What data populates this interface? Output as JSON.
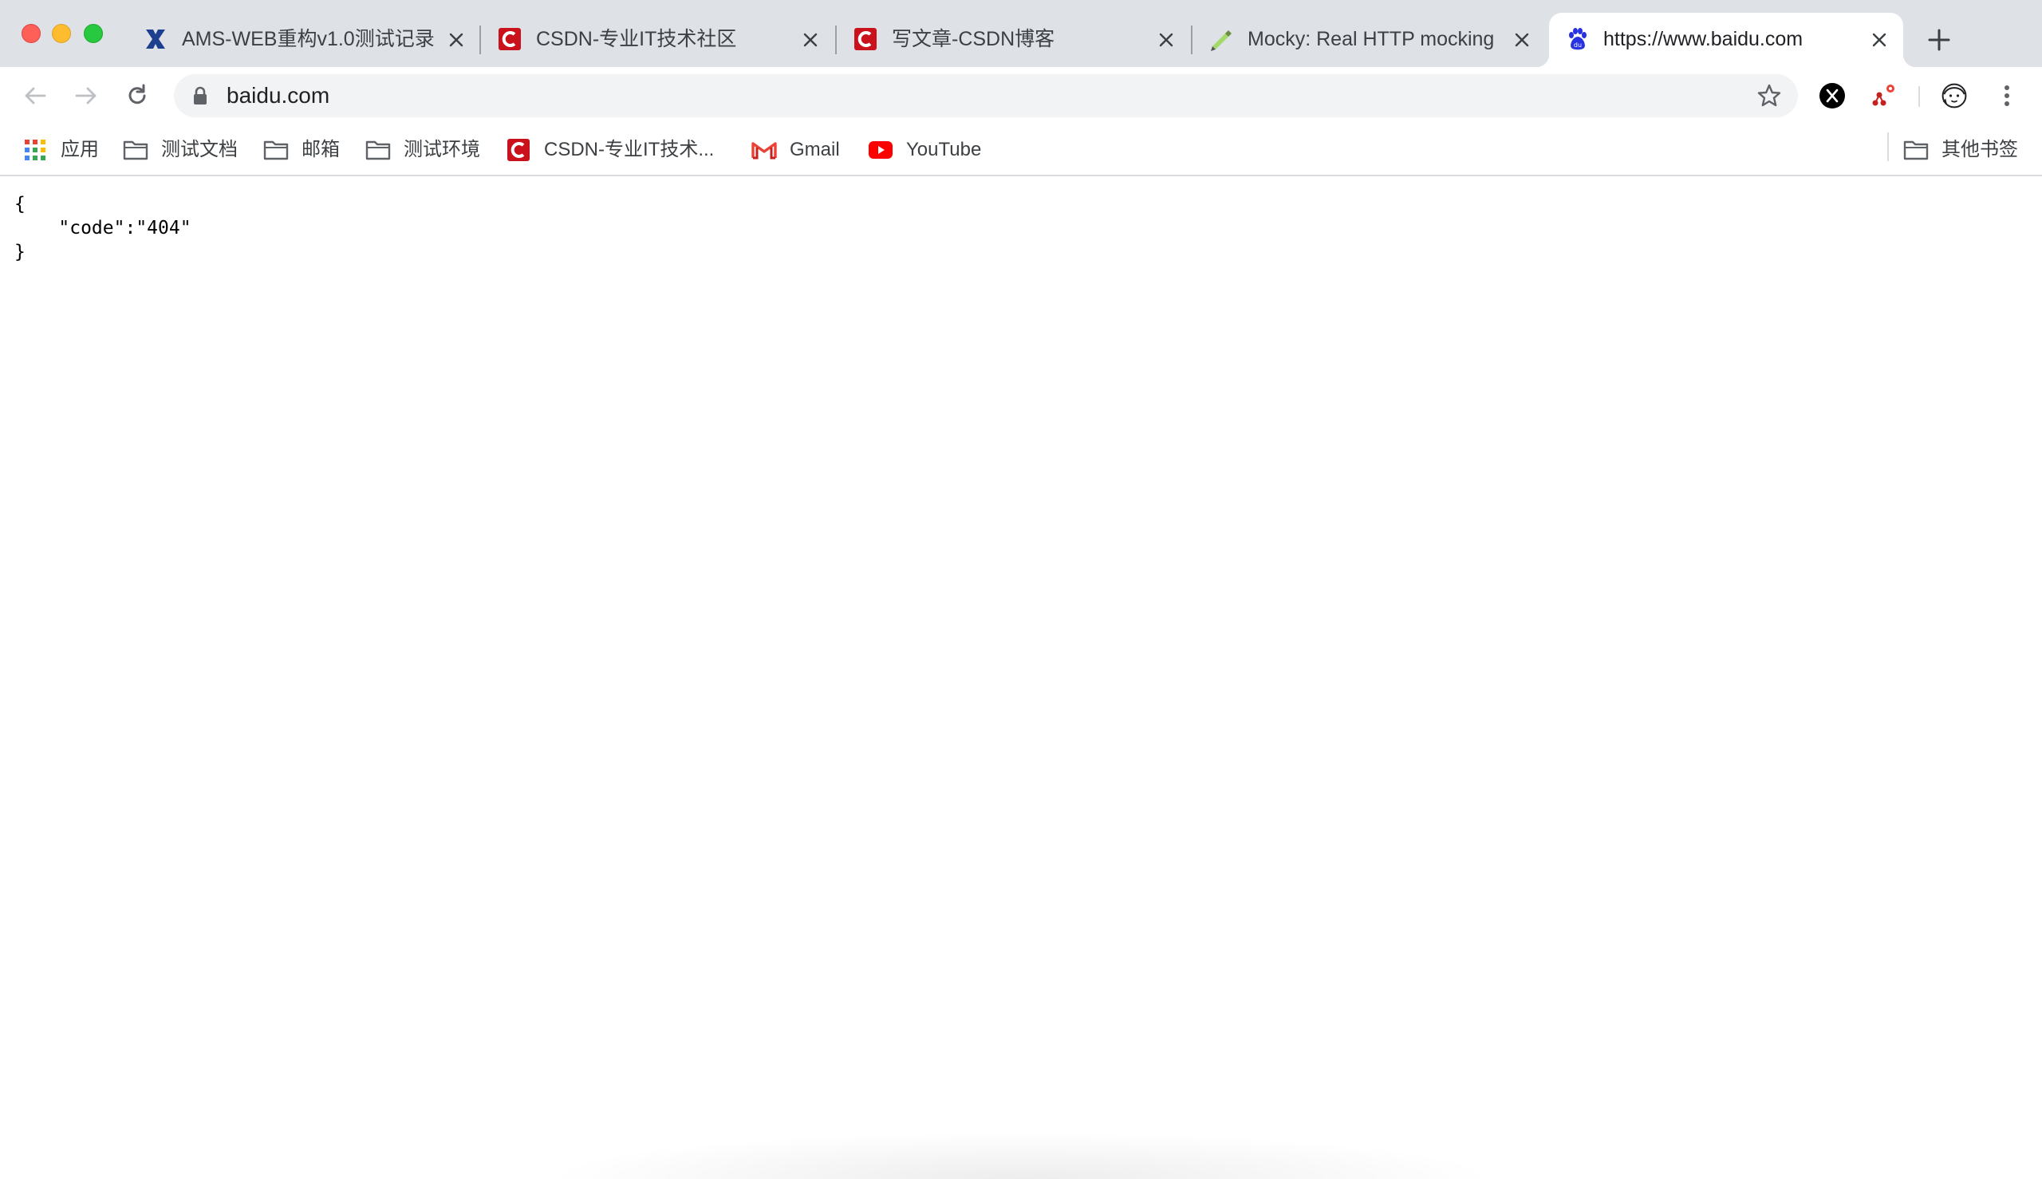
{
  "tabs": [
    {
      "title": "AMS-WEB重构v1.0测试记录",
      "icon": "xmind-x-icon",
      "active": false
    },
    {
      "title": "CSDN-专业IT技术社区",
      "icon": "csdn-icon",
      "active": false
    },
    {
      "title": "写文章-CSDN博客",
      "icon": "csdn-icon",
      "active": false
    },
    {
      "title": "Mocky: Real HTTP mocking",
      "icon": "mocky-icon",
      "active": false
    },
    {
      "title": "https://www.baidu.com",
      "icon": "baidu-paw-icon",
      "active": true
    }
  ],
  "omnibox": {
    "url": "baidu.com"
  },
  "bookmarks": {
    "apps_label": "应用",
    "items": [
      {
        "label": "测试文档",
        "icon": "folder-icon"
      },
      {
        "label": "邮箱",
        "icon": "folder-icon"
      },
      {
        "label": "测试环境",
        "icon": "folder-icon"
      },
      {
        "label": "CSDN-专业IT技术...",
        "icon": "csdn-icon"
      },
      {
        "label": "Gmail",
        "icon": "gmail-icon"
      },
      {
        "label": "YouTube",
        "icon": "youtube-icon"
      }
    ],
    "other_label": "其他书签"
  },
  "page": {
    "json_text": "{\n    \"code\":\"404\"\n}"
  },
  "colors": {
    "tabstrip_bg": "#dee1e6",
    "csdn_red": "#c9121b",
    "youtube_red": "#ff0000",
    "baidu_blue": "#2932e1"
  }
}
